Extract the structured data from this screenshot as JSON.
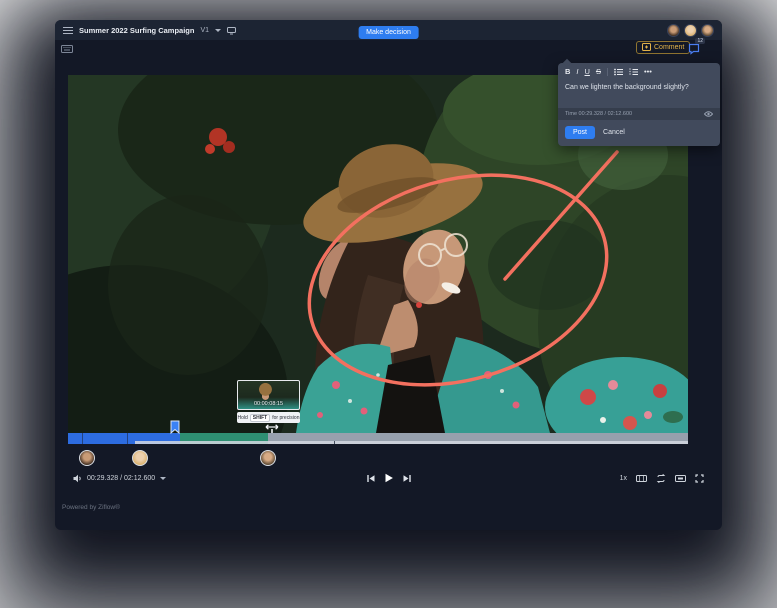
{
  "header": {
    "title": "Summer 2022 Surfing Campaign",
    "version_label": "V1",
    "make_decision_label": "Make decision"
  },
  "toolbar": {
    "comment_label": "Comment",
    "comment_badge": "12"
  },
  "comment_popup": {
    "bold_label": "B",
    "italic_label": "I",
    "underline_label": "U",
    "strikethrough_label": "S",
    "more_label": "•••",
    "comment_text": "Can we lighten the background slightly?",
    "time_label": "Time 00:29.328 / 02:12.600",
    "post_label": "Post",
    "cancel_label": "Cancel"
  },
  "timeline": {
    "thumbnail_timestamp": "00:00:08:15",
    "tooltip_hold": "Hold",
    "tooltip_key": "SHIFT",
    "tooltip_rest": "for precision",
    "segments": [
      {
        "name": "reviewed-blue",
        "color": "#2d6ce0",
        "width_pct": 18.1
      },
      {
        "name": "selection-green",
        "color": "#2e8f72",
        "width_pct": 14.2
      },
      {
        "name": "remaining-gray",
        "color": "#97a0ad",
        "width_pct": 67.7
      }
    ]
  },
  "playback": {
    "time_display": "00:29.328 / 02:12.600",
    "speed_label": "1x"
  },
  "footer": {
    "powered_by": "Powered by Ziflow®"
  },
  "colors": {
    "accent_blue": "#2e7df0",
    "accent_gold": "#e3b34a",
    "annotation": "#f3705f",
    "timeline_blue": "#2d6ce0",
    "timeline_green": "#2e8f72",
    "timeline_gray": "#97a0ad"
  }
}
